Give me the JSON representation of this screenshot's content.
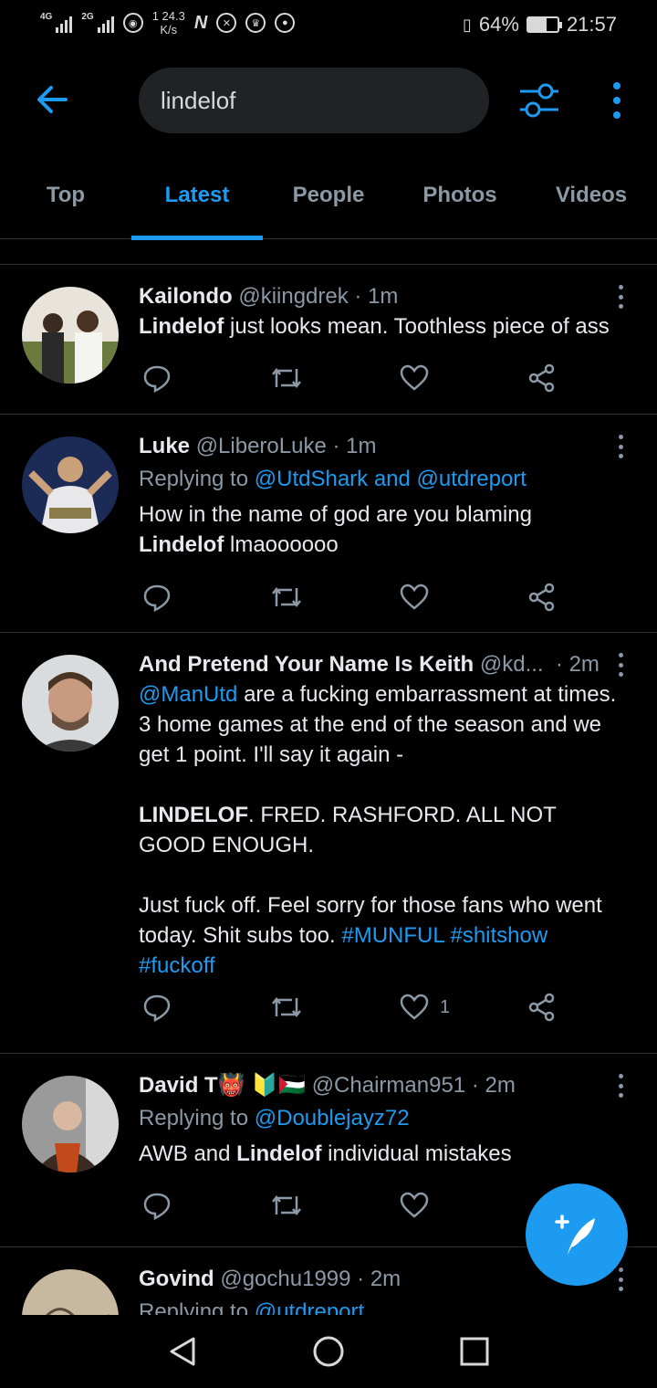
{
  "status_bar": {
    "network1": "4G",
    "network2": "2G",
    "speed_value": "24.3",
    "speed_unit": "K/s",
    "speed_prefix": "1",
    "nfc": "N",
    "battery_percent": "64%",
    "battery_level": 0.64,
    "time": "21:57"
  },
  "search": {
    "query": "lindelof"
  },
  "tabs": [
    {
      "label": "Top",
      "active": false
    },
    {
      "label": "Latest",
      "active": true
    },
    {
      "label": "People",
      "active": false
    },
    {
      "label": "Photos",
      "active": false
    },
    {
      "label": "Videos",
      "active": false
    }
  ],
  "tweets": [
    {
      "name": "Kailondo",
      "handle": "@kiingdrek",
      "time": "· 1m",
      "highlight": "Lindelof",
      "text": " just looks mean. Toothless piece of ass"
    },
    {
      "name": "Luke",
      "handle": "@LiberoLuke",
      "time": "· 1m",
      "reply_prefix": "Replying to ",
      "reply_to": "@UtdShark and @utdreport",
      "text1": "How in the name of god are you blaming",
      "highlight": "Lindelof",
      "text2": " lmaoooooo"
    },
    {
      "name": "And Pretend Your Name Is Keith",
      "handle": "@kd...",
      "time": "· 2m",
      "mention": "@ManUtd",
      "text1": " are a fucking embarrassment at times. 3 home games at the end of the season and we get 1 point. I'll say it again -",
      "highlight": "LINDELOF",
      "text2": ". FRED. RASHFORD. ALL NOT GOOD ENOUGH.",
      "text3": "Just fuck off. Feel sorry for those fans who went today. Shit subs too. ",
      "hashtag1": "#MUNFUL",
      "hashtag2": "#shitshow",
      "hashtag3": "#fuckoff",
      "like_count": "1"
    },
    {
      "name": "David T",
      "emoji": "👹 🔰🇵🇸",
      "handle": "@Chairman951",
      "time": "· 2m",
      "reply_prefix": "Replying to ",
      "reply_to": "@Doublejayz72",
      "text1": "AWB and ",
      "highlight": "Lindelof",
      "text2": " individual mistakes"
    },
    {
      "name": "Govind",
      "handle": "@gochu1999",
      "time": "· 2m",
      "reply_prefix": "Replying to ",
      "reply_to": "@utdreport"
    }
  ],
  "colors": {
    "accent": "#1d9bf0",
    "background": "#000000",
    "divider": "#2f3336",
    "secondary_text": "#8b98a5"
  }
}
